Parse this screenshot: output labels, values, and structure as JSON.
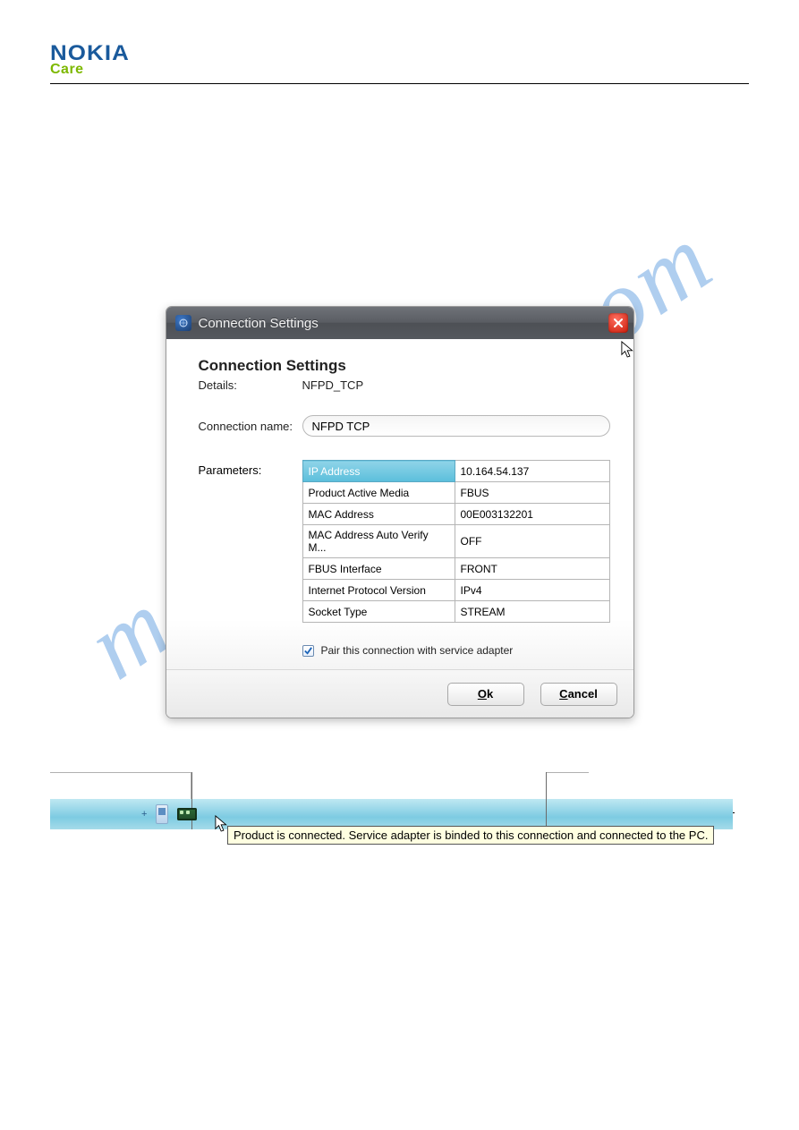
{
  "branding": {
    "logo_primary": "NOKIA",
    "logo_secondary": "Care"
  },
  "watermark": "manualshive.com",
  "dialog": {
    "title": "Connection Settings",
    "heading": "Connection Settings",
    "details_label": "Details:",
    "details_value": "NFPD_TCP",
    "connection_name_label": "Connection name:",
    "connection_name_value": "NFPD TCP",
    "parameters_label": "Parameters:",
    "params": [
      {
        "key": "IP Address",
        "value": "10.164.54.137",
        "selected": true
      },
      {
        "key": "Product Active Media",
        "value": "FBUS"
      },
      {
        "key": "MAC Address",
        "value": "00E003132201"
      },
      {
        "key": "MAC Address Auto Verify M...",
        "value": "OFF"
      },
      {
        "key": "FBUS Interface",
        "value": "FRONT"
      },
      {
        "key": "Internet Protocol Version",
        "value": "IPv4"
      },
      {
        "key": "Socket Type",
        "value": "STREAM"
      }
    ],
    "pair_checkbox_label": "Pair this connection with service adapter",
    "pair_checked": true,
    "ok_label": "Ok",
    "cancel_label": "Cancel"
  },
  "tooltip_text": "Product is connected. Service adapter is binded to this connection and connected to the PC."
}
